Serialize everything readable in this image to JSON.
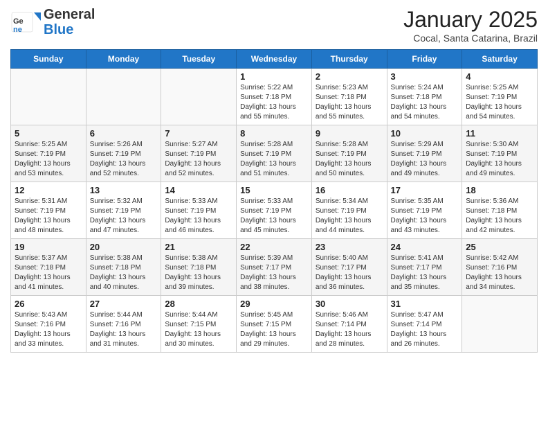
{
  "logo": {
    "general": "General",
    "blue": "Blue"
  },
  "title": "January 2025",
  "location": "Cocal, Santa Catarina, Brazil",
  "days_of_week": [
    "Sunday",
    "Monday",
    "Tuesday",
    "Wednesday",
    "Thursday",
    "Friday",
    "Saturday"
  ],
  "weeks": [
    [
      {
        "day": "",
        "info": ""
      },
      {
        "day": "",
        "info": ""
      },
      {
        "day": "",
        "info": ""
      },
      {
        "day": "1",
        "info": "Sunrise: 5:22 AM\nSunset: 7:18 PM\nDaylight: 13 hours\nand 55 minutes."
      },
      {
        "day": "2",
        "info": "Sunrise: 5:23 AM\nSunset: 7:18 PM\nDaylight: 13 hours\nand 55 minutes."
      },
      {
        "day": "3",
        "info": "Sunrise: 5:24 AM\nSunset: 7:18 PM\nDaylight: 13 hours\nand 54 minutes."
      },
      {
        "day": "4",
        "info": "Sunrise: 5:25 AM\nSunset: 7:19 PM\nDaylight: 13 hours\nand 54 minutes."
      }
    ],
    [
      {
        "day": "5",
        "info": "Sunrise: 5:25 AM\nSunset: 7:19 PM\nDaylight: 13 hours\nand 53 minutes."
      },
      {
        "day": "6",
        "info": "Sunrise: 5:26 AM\nSunset: 7:19 PM\nDaylight: 13 hours\nand 52 minutes."
      },
      {
        "day": "7",
        "info": "Sunrise: 5:27 AM\nSunset: 7:19 PM\nDaylight: 13 hours\nand 52 minutes."
      },
      {
        "day": "8",
        "info": "Sunrise: 5:28 AM\nSunset: 7:19 PM\nDaylight: 13 hours\nand 51 minutes."
      },
      {
        "day": "9",
        "info": "Sunrise: 5:28 AM\nSunset: 7:19 PM\nDaylight: 13 hours\nand 50 minutes."
      },
      {
        "day": "10",
        "info": "Sunrise: 5:29 AM\nSunset: 7:19 PM\nDaylight: 13 hours\nand 49 minutes."
      },
      {
        "day": "11",
        "info": "Sunrise: 5:30 AM\nSunset: 7:19 PM\nDaylight: 13 hours\nand 49 minutes."
      }
    ],
    [
      {
        "day": "12",
        "info": "Sunrise: 5:31 AM\nSunset: 7:19 PM\nDaylight: 13 hours\nand 48 minutes."
      },
      {
        "day": "13",
        "info": "Sunrise: 5:32 AM\nSunset: 7:19 PM\nDaylight: 13 hours\nand 47 minutes."
      },
      {
        "day": "14",
        "info": "Sunrise: 5:33 AM\nSunset: 7:19 PM\nDaylight: 13 hours\nand 46 minutes."
      },
      {
        "day": "15",
        "info": "Sunrise: 5:33 AM\nSunset: 7:19 PM\nDaylight: 13 hours\nand 45 minutes."
      },
      {
        "day": "16",
        "info": "Sunrise: 5:34 AM\nSunset: 7:19 PM\nDaylight: 13 hours\nand 44 minutes."
      },
      {
        "day": "17",
        "info": "Sunrise: 5:35 AM\nSunset: 7:19 PM\nDaylight: 13 hours\nand 43 minutes."
      },
      {
        "day": "18",
        "info": "Sunrise: 5:36 AM\nSunset: 7:18 PM\nDaylight: 13 hours\nand 42 minutes."
      }
    ],
    [
      {
        "day": "19",
        "info": "Sunrise: 5:37 AM\nSunset: 7:18 PM\nDaylight: 13 hours\nand 41 minutes."
      },
      {
        "day": "20",
        "info": "Sunrise: 5:38 AM\nSunset: 7:18 PM\nDaylight: 13 hours\nand 40 minutes."
      },
      {
        "day": "21",
        "info": "Sunrise: 5:38 AM\nSunset: 7:18 PM\nDaylight: 13 hours\nand 39 minutes."
      },
      {
        "day": "22",
        "info": "Sunrise: 5:39 AM\nSunset: 7:17 PM\nDaylight: 13 hours\nand 38 minutes."
      },
      {
        "day": "23",
        "info": "Sunrise: 5:40 AM\nSunset: 7:17 PM\nDaylight: 13 hours\nand 36 minutes."
      },
      {
        "day": "24",
        "info": "Sunrise: 5:41 AM\nSunset: 7:17 PM\nDaylight: 13 hours\nand 35 minutes."
      },
      {
        "day": "25",
        "info": "Sunrise: 5:42 AM\nSunset: 7:16 PM\nDaylight: 13 hours\nand 34 minutes."
      }
    ],
    [
      {
        "day": "26",
        "info": "Sunrise: 5:43 AM\nSunset: 7:16 PM\nDaylight: 13 hours\nand 33 minutes."
      },
      {
        "day": "27",
        "info": "Sunrise: 5:44 AM\nSunset: 7:16 PM\nDaylight: 13 hours\nand 31 minutes."
      },
      {
        "day": "28",
        "info": "Sunrise: 5:44 AM\nSunset: 7:15 PM\nDaylight: 13 hours\nand 30 minutes."
      },
      {
        "day": "29",
        "info": "Sunrise: 5:45 AM\nSunset: 7:15 PM\nDaylight: 13 hours\nand 29 minutes."
      },
      {
        "day": "30",
        "info": "Sunrise: 5:46 AM\nSunset: 7:14 PM\nDaylight: 13 hours\nand 28 minutes."
      },
      {
        "day": "31",
        "info": "Sunrise: 5:47 AM\nSunset: 7:14 PM\nDaylight: 13 hours\nand 26 minutes."
      },
      {
        "day": "",
        "info": ""
      }
    ]
  ]
}
